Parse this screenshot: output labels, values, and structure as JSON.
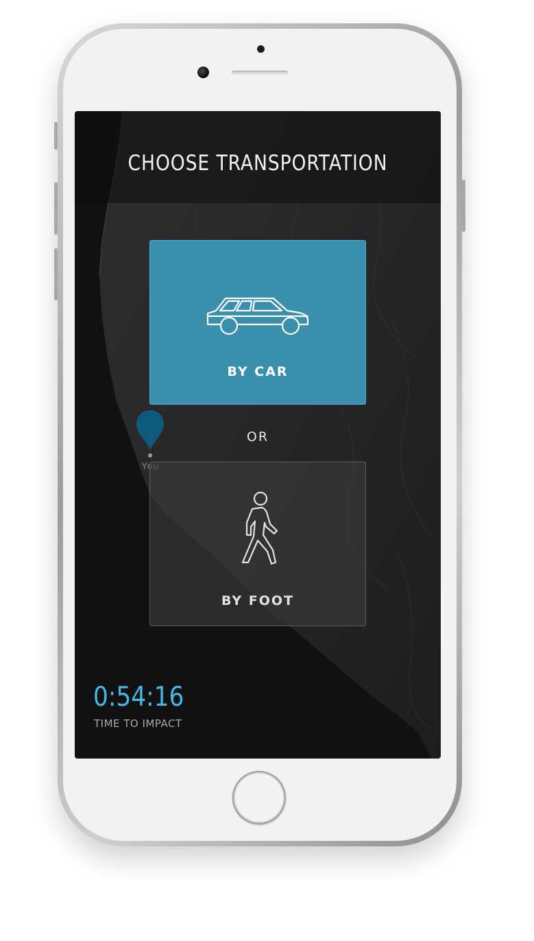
{
  "screen": {
    "title": "CHOOSE TRANSPORTATION"
  },
  "options": {
    "car": {
      "label": "BY CAR",
      "icon": "car-icon",
      "selected": true
    },
    "separator": "OR",
    "foot": {
      "label": "BY FOOT",
      "icon": "walking-person-icon",
      "selected": false
    }
  },
  "map": {
    "pin_label": "You",
    "pin_icon": "location-pin-icon"
  },
  "countdown": {
    "time": "0:54:16",
    "caption": "TIME TO IMPACT"
  },
  "colors": {
    "accent": "#3a8fac",
    "timer": "#45b6e6",
    "background": "#111112"
  }
}
